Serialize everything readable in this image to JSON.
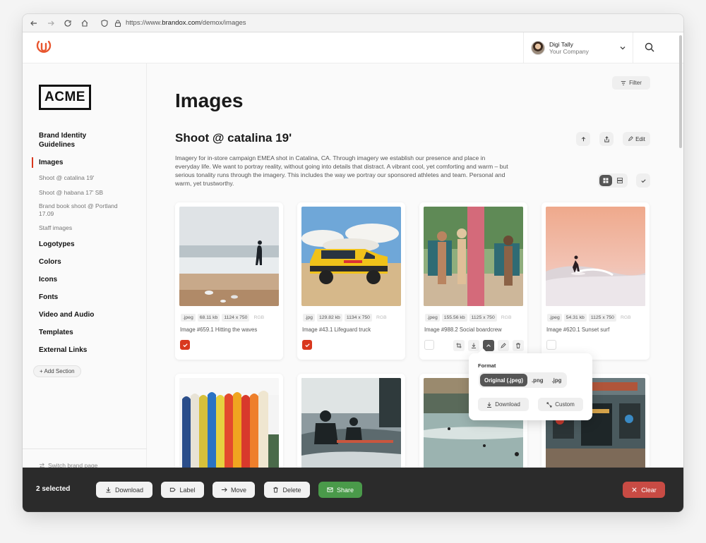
{
  "browser": {
    "url_prefix": "https://www.",
    "url_domain": "brandox.com",
    "url_path": "/demox/images"
  },
  "header": {
    "user_name": "Digi Tally",
    "user_company": "Your Company"
  },
  "sidebar": {
    "logo_text": "ACME",
    "items": [
      {
        "label": "Brand Identity Guidelines"
      },
      {
        "label": "Images"
      },
      {
        "label": "Logotypes"
      },
      {
        "label": "Colors"
      },
      {
        "label": "Icons"
      },
      {
        "label": "Fonts"
      },
      {
        "label": "Video and Audio"
      },
      {
        "label": "Templates"
      },
      {
        "label": "External Links"
      }
    ],
    "subitems": [
      {
        "label": "Shoot @ catalina 19'"
      },
      {
        "label": "Shoot @ habana 17' SB"
      },
      {
        "label": "Brand book shoot @ Portland 17.09"
      },
      {
        "label": "Staff images"
      }
    ],
    "add_section": "+ Add Section",
    "switch_brand": "Switch brand page"
  },
  "main": {
    "filter_label": "Filter",
    "title": "Images",
    "section_title": "Shoot @ catalina 19'",
    "edit_label": "Edit",
    "description": "Imagery for in-store campaign EMEA shot in Catalina, CA. Through imagery we establish our presence and place in everyday life. We want to portray reality, without going into details that distract. A vibrant cool, yet comforting and warm – but serious tonality runs through the imagery. This includes the way we portray our sponsored athletes and team. Personal and warm, yet trustworthy."
  },
  "cards": [
    {
      "ext": ".jpeg",
      "size": "68.11 kb",
      "dims": "1124 x 750",
      "color": "RGB",
      "title": "Image #659.1 Hitting the waves",
      "checked": true
    },
    {
      "ext": ".jpg",
      "size": "129.82 kb",
      "dims": "1134 x 750",
      "color": "RGB",
      "title": "Image #43.1 Lifeguard truck",
      "checked": true
    },
    {
      "ext": ".jpeg",
      "size": "155.56 kb",
      "dims": "1125 x 750",
      "color": "RGB",
      "title": "Image #988.2 Social boardcrew",
      "checked": false
    },
    {
      "ext": ".jpeg",
      "size": "54.31 kb",
      "dims": "1125 x 750",
      "color": "RGB",
      "title": "Image #620.1 Sunset surf",
      "checked": false
    }
  ],
  "popover": {
    "label": "Format",
    "formats": [
      "Original (.jpeg)",
      ".png",
      ".jpg"
    ],
    "selected_format": "Original (.jpeg)",
    "download_label": "Download",
    "custom_label": "Custom"
  },
  "actionbar": {
    "selected_text": "2 selected",
    "download": "Download",
    "label": "Label",
    "move": "Move",
    "delete": "Delete",
    "share": "Share",
    "clear": "Clear"
  },
  "colors": {
    "accent_red": "#d9381e",
    "share_green": "#4a9a4a",
    "clear_red": "#c84b44",
    "actionbar_bg": "#2b2b2b"
  }
}
